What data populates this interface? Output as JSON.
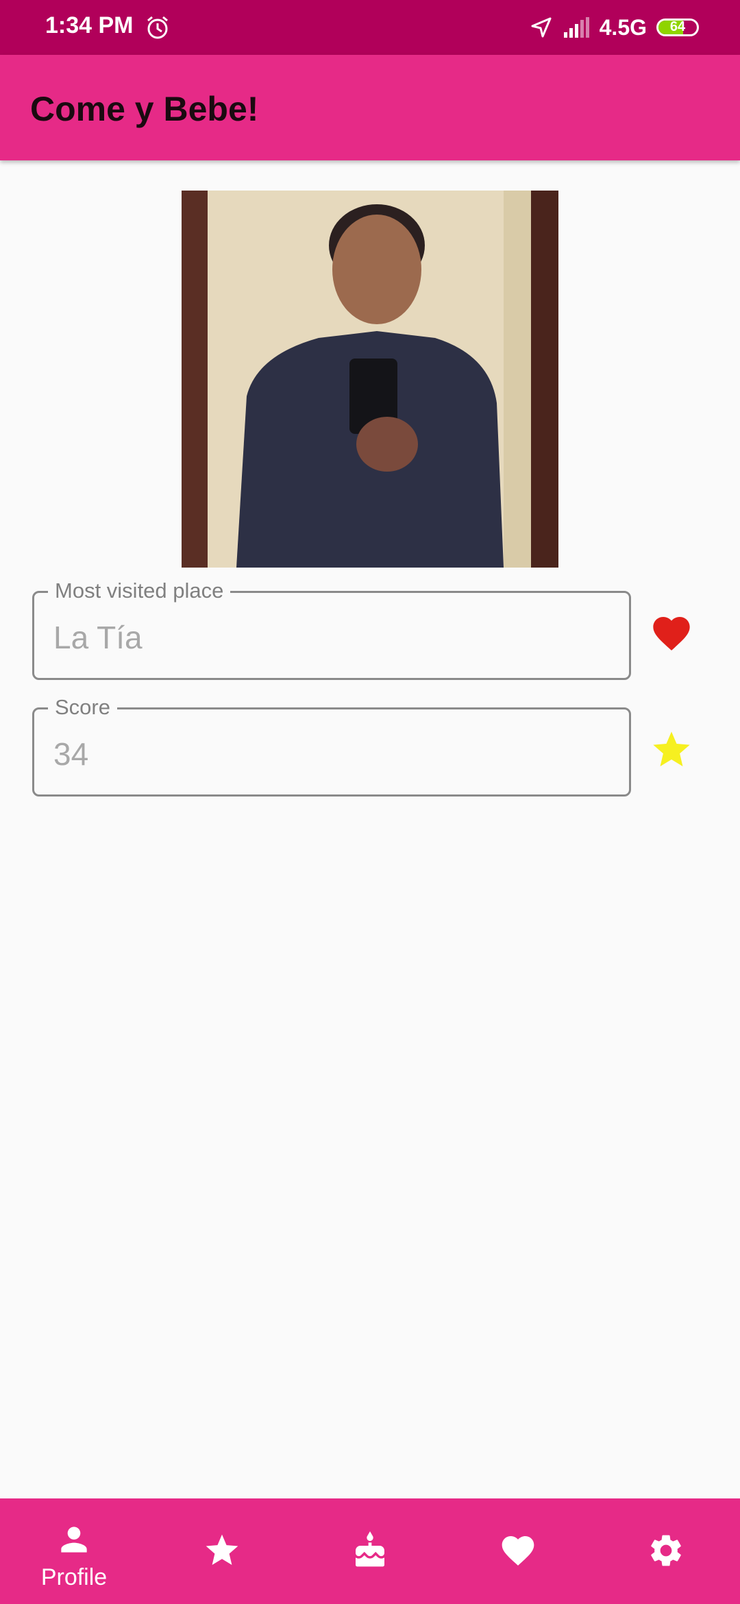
{
  "status_bar": {
    "time": "1:34 PM",
    "network": "4.5G",
    "battery_level": "64",
    "icons": [
      "alarm-icon",
      "location-arrow-icon",
      "signal-icon",
      "battery-icon"
    ]
  },
  "app_bar": {
    "title": "Come y Bebe!"
  },
  "profile": {
    "photo_icon": "profile-photo"
  },
  "fields": {
    "place": {
      "label": "Most visited place",
      "value": "La Tía",
      "icon": "heart-icon",
      "icon_color": "#e0201a"
    },
    "score": {
      "label": "Score",
      "value": "34",
      "icon": "star-icon",
      "icon_color": "#f6f020"
    }
  },
  "bottom_nav": {
    "items": [
      {
        "label": "Profile",
        "icon": "person-icon",
        "selected": true
      },
      {
        "label": "",
        "icon": "star-icon"
      },
      {
        "label": "",
        "icon": "cake-icon"
      },
      {
        "label": "",
        "icon": "heart-icon"
      },
      {
        "label": "",
        "icon": "gear-icon"
      }
    ]
  },
  "colors": {
    "status_bar": "#b1005a",
    "primary": "#e62a87",
    "background": "#fafafa"
  }
}
